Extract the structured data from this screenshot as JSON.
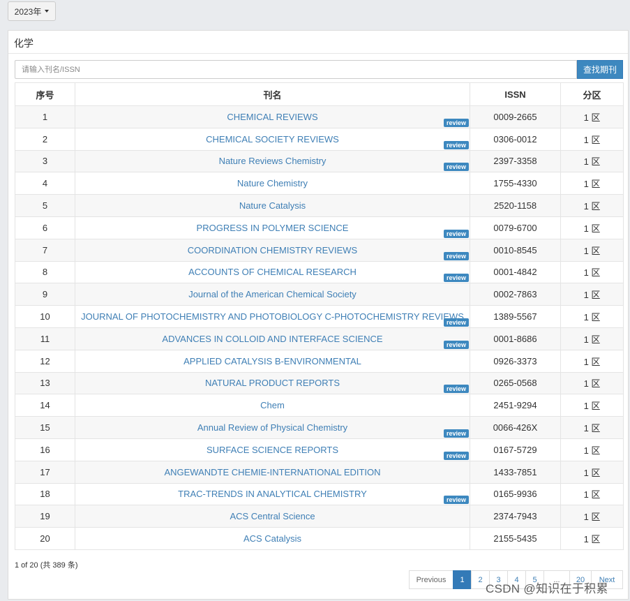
{
  "year_selector": {
    "label": "2023年"
  },
  "panel": {
    "title": "化学"
  },
  "search": {
    "placeholder": "请输入刊名/ISSN",
    "button_label": "查找期刊"
  },
  "table": {
    "headers": [
      "序号",
      "刊名",
      "ISSN",
      "分区"
    ],
    "review_label": "review",
    "rows": [
      {
        "no": "1",
        "name": "CHEMICAL REVIEWS",
        "issn": "0009-2665",
        "zone": "1 区",
        "review": true
      },
      {
        "no": "2",
        "name": "CHEMICAL SOCIETY REVIEWS",
        "issn": "0306-0012",
        "zone": "1 区",
        "review": true
      },
      {
        "no": "3",
        "name": "Nature Reviews Chemistry",
        "issn": "2397-3358",
        "zone": "1 区",
        "review": true
      },
      {
        "no": "4",
        "name": "Nature Chemistry",
        "issn": "1755-4330",
        "zone": "1 区",
        "review": false
      },
      {
        "no": "5",
        "name": "Nature Catalysis",
        "issn": "2520-1158",
        "zone": "1 区",
        "review": false
      },
      {
        "no": "6",
        "name": "PROGRESS IN POLYMER SCIENCE",
        "issn": "0079-6700",
        "zone": "1 区",
        "review": true
      },
      {
        "no": "7",
        "name": "COORDINATION CHEMISTRY REVIEWS",
        "issn": "0010-8545",
        "zone": "1 区",
        "review": true
      },
      {
        "no": "8",
        "name": "ACCOUNTS OF CHEMICAL RESEARCH",
        "issn": "0001-4842",
        "zone": "1 区",
        "review": true
      },
      {
        "no": "9",
        "name": "Journal of the American Chemical Society",
        "issn": "0002-7863",
        "zone": "1 区",
        "review": false
      },
      {
        "no": "10",
        "name": "JOURNAL OF PHOTOCHEMISTRY AND PHOTOBIOLOGY C-PHOTOCHEMISTRY REVIEWS",
        "issn": "1389-5567",
        "zone": "1 区",
        "review": true
      },
      {
        "no": "11",
        "name": "ADVANCES IN COLLOID AND INTERFACE SCIENCE",
        "issn": "0001-8686",
        "zone": "1 区",
        "review": true
      },
      {
        "no": "12",
        "name": "APPLIED CATALYSIS B-ENVIRONMENTAL",
        "issn": "0926-3373",
        "zone": "1 区",
        "review": false
      },
      {
        "no": "13",
        "name": "NATURAL PRODUCT REPORTS",
        "issn": "0265-0568",
        "zone": "1 区",
        "review": true
      },
      {
        "no": "14",
        "name": "Chem",
        "issn": "2451-9294",
        "zone": "1 区",
        "review": false
      },
      {
        "no": "15",
        "name": "Annual Review of Physical Chemistry",
        "issn": "0066-426X",
        "zone": "1 区",
        "review": true
      },
      {
        "no": "16",
        "name": "SURFACE SCIENCE REPORTS",
        "issn": "0167-5729",
        "zone": "1 区",
        "review": true
      },
      {
        "no": "17",
        "name": "ANGEWANDTE CHEMIE-INTERNATIONAL EDITION",
        "issn": "1433-7851",
        "zone": "1 区",
        "review": false
      },
      {
        "no": "18",
        "name": "TRAC-TRENDS IN ANALYTICAL CHEMISTRY",
        "issn": "0165-9936",
        "zone": "1 区",
        "review": true
      },
      {
        "no": "19",
        "name": "ACS Central Science",
        "issn": "2374-7943",
        "zone": "1 区",
        "review": false
      },
      {
        "no": "20",
        "name": "ACS Catalysis",
        "issn": "2155-5435",
        "zone": "1 区",
        "review": false
      }
    ]
  },
  "summary": "1 of 20 (共 389 条)",
  "pagination": {
    "previous": "Previous",
    "pages": [
      "1",
      "2",
      "3",
      "4",
      "5",
      "...",
      "20"
    ],
    "active": "1",
    "next": "Next"
  },
  "watermark": "CSDN @知识在于积累"
}
